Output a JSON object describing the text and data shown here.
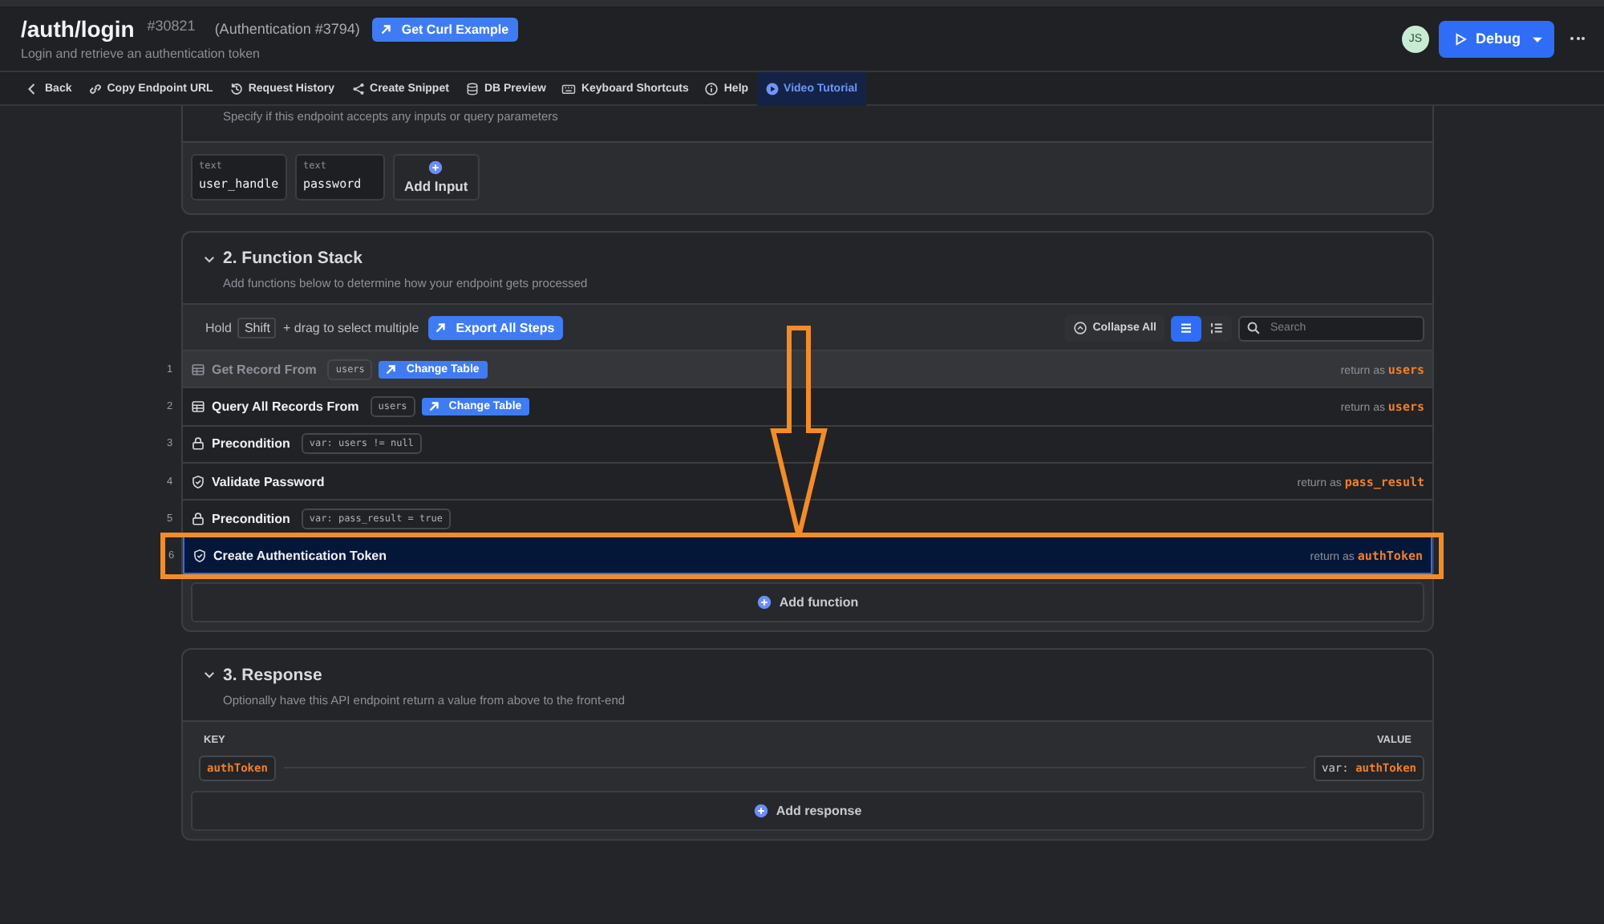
{
  "header": {
    "title": "/auth/login",
    "id": "#30821",
    "group": "(Authentication #3794)",
    "curl_button": "Get Curl Example",
    "subtitle": "Login and retrieve an authentication token",
    "avatar": "JS",
    "debug_button": "Debug"
  },
  "toolbar": [
    {
      "label": "Back",
      "kind": "back",
      "active": false
    },
    {
      "label": "Copy Endpoint URL",
      "kind": "link",
      "active": false
    },
    {
      "label": "Request History",
      "kind": "history",
      "active": false
    },
    {
      "label": "Create Snippet",
      "kind": "share",
      "active": false
    },
    {
      "label": "DB Preview",
      "kind": "db",
      "active": false
    },
    {
      "label": "Keyboard Shortcuts",
      "kind": "keyboard",
      "active": false
    },
    {
      "label": "Help",
      "kind": "info",
      "active": false
    },
    {
      "label": "Video Tutorial",
      "kind": "play",
      "active": true
    }
  ],
  "inputs": {
    "description": "Specify if this endpoint accepts any inputs or query parameters",
    "fields": [
      {
        "type": "text",
        "name": "user_handle"
      },
      {
        "type": "text",
        "name": "password"
      }
    ],
    "add_button": "Add Input"
  },
  "function_stack": {
    "title": "2. Function Stack",
    "description": "Add functions below to determine how your endpoint gets processed",
    "hold": "Hold",
    "key": "Shift",
    "hint": "+ drag to select multiple",
    "export_button": "Export All Steps",
    "collapse_button": "Collapse All",
    "views": [
      {
        "kind": "list",
        "selected": true
      },
      {
        "kind": "numbered",
        "selected": false
      }
    ],
    "search_placeholder": "Search",
    "steps": [
      {
        "number": "1",
        "kind": "table",
        "name": "Get Record From",
        "tag": "users",
        "change_button": "Change Table",
        "return_label": "return as",
        "return_var": "users",
        "disabled": true,
        "selected": false
      },
      {
        "number": "2",
        "kind": "table",
        "name": "Query All Records From",
        "tag": "users",
        "change_button": "Change Table",
        "return_label": "return as",
        "return_var": "users",
        "disabled": false,
        "selected": false
      },
      {
        "number": "3",
        "kind": "lock",
        "name": "Precondition",
        "tag_prefix": "var:",
        "tag": "users != null",
        "disabled": false,
        "selected": false
      },
      {
        "number": "4",
        "kind": "shield",
        "name": "Validate Password",
        "return_label": "return as",
        "return_var": "pass_result",
        "disabled": false,
        "selected": false
      },
      {
        "number": "5",
        "kind": "lock",
        "name": "Precondition",
        "tag_prefix": "var:",
        "tag": "pass_result = true",
        "disabled": false,
        "selected": false
      },
      {
        "number": "6",
        "kind": "shield",
        "name": "Create Authentication Token",
        "return_label": "return as",
        "return_var": "authToken",
        "disabled": false,
        "selected": true
      }
    ],
    "add_button": "Add function"
  },
  "response": {
    "title": "3. Response",
    "description": "Optionally have this API endpoint return a value from above to the front-end",
    "key_header": "KEY",
    "value_header": "VALUE",
    "rows": [
      {
        "key": "authToken",
        "value_prefix": "var:",
        "value": "authToken"
      }
    ],
    "add_button": "Add response"
  }
}
